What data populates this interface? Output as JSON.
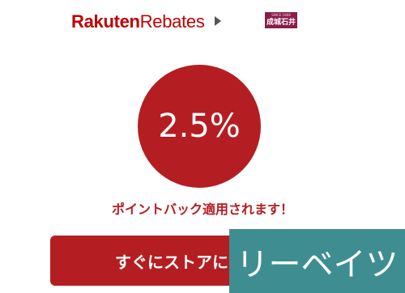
{
  "header": {
    "brand": "Rakuten",
    "product": "Rebates",
    "store_logo_sub": "SINCE 1868",
    "store_logo_main": "成城石井"
  },
  "cashback": {
    "rate": "2.5%",
    "notice": "ポイントバック適用されます！"
  },
  "cta": {
    "label": "すぐにストアに"
  },
  "overlay": {
    "text": "リーベイツ"
  },
  "colors": {
    "brand_red": "#bf0000",
    "circle_red": "#b41e22",
    "overlay_teal": "#3e8e91"
  }
}
